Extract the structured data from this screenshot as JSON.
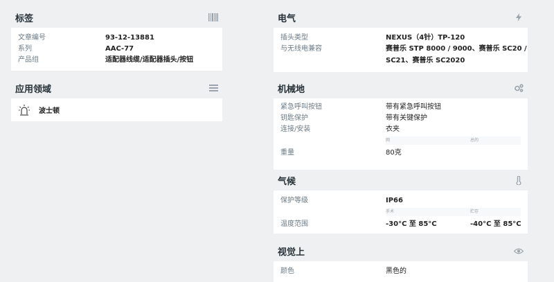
{
  "tags": {
    "title": "标签",
    "rows": [
      {
        "label": "文章编号",
        "value": "93-12-13881"
      },
      {
        "label": "系列",
        "value": "AAC-77"
      },
      {
        "label": "产品组",
        "value": "适配器线缆/适配器插头/按钮"
      }
    ]
  },
  "application": {
    "title": "应用领域",
    "item": "波士顿"
  },
  "electrical": {
    "title": "电气",
    "plug_label": "插头类型",
    "plug_value": "NEXUS（4针）TP-120",
    "compat_label": "与无线电兼容",
    "compat_line1": "赛普乐 STP 8000 / 9000、赛普乐 SC20 /",
    "compat_line2": "SC21、赛普乐 SC2020"
  },
  "mechanical": {
    "title": "机械地",
    "rows": [
      {
        "label": "紧急呼叫按钮",
        "value": "带有紧急呼叫按钮"
      },
      {
        "label": "钥匙保护",
        "value": "带有关键保护"
      },
      {
        "label": "连接/安装",
        "value": "衣夹"
      }
    ],
    "sub_col1": "网",
    "sub_col2": "总的",
    "weight_label": "重量",
    "weight_value": "80克"
  },
  "climate": {
    "title": "气候",
    "protection_label": "保护等级",
    "protection_value": "IP66",
    "sub_col1": "手术",
    "sub_col2": "贮存",
    "temp_label": "温度范围",
    "temp_operation": "-30°C 至 85°C",
    "temp_storage": "-40°C 至 85°C"
  },
  "visual": {
    "title": "视觉上",
    "color_label": "颜色",
    "color_value": "黑色的"
  }
}
